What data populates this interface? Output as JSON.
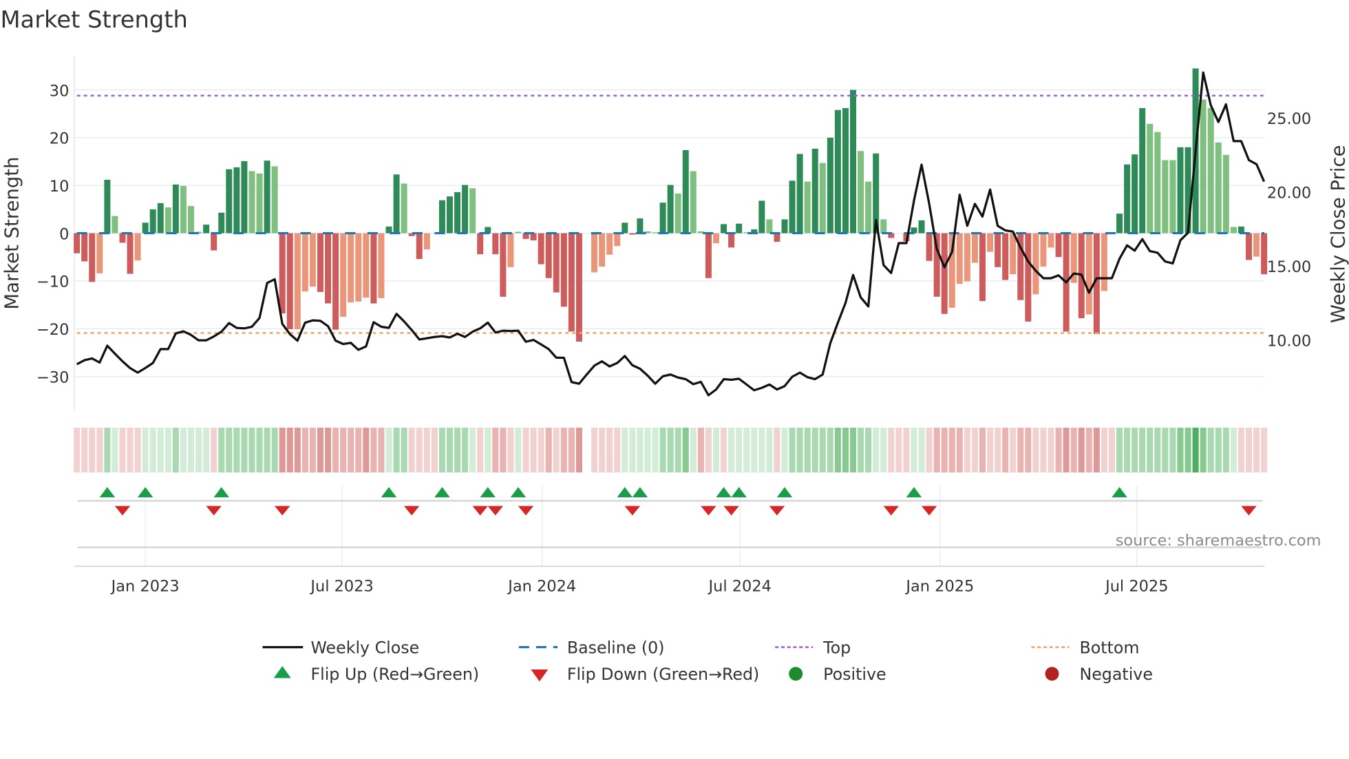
{
  "title": "Market Strength",
  "source": "source: sharemaestro.com",
  "chart_data": {
    "type": "bar+line",
    "title": "Market Strength",
    "ylabel": "Market Strength",
    "y2label": "Weekly Close Price",
    "ylim": [
      -37.2,
      37.1
    ],
    "y2lim": [
      5.17,
      29.19
    ],
    "start_date": "2022-10-30",
    "interval_days": 7,
    "y_ticks": [
      {
        "v": 30,
        "label": "30"
      },
      {
        "v": 20,
        "label": "20"
      },
      {
        "v": 10,
        "label": "10"
      },
      {
        "v": 0,
        "label": "0"
      },
      {
        "v": -10,
        "label": "−10"
      },
      {
        "v": -20,
        "label": "−20"
      },
      {
        "v": -30,
        "label": "−30"
      }
    ],
    "y2_ticks": [
      {
        "v": 25,
        "label": "25.00"
      },
      {
        "v": 20,
        "label": "20.00"
      },
      {
        "v": 15,
        "label": "15.00"
      },
      {
        "v": 10,
        "label": "10.00"
      }
    ],
    "x_ticks": [
      {
        "date": "2023-01-01",
        "label": "Jan 2023"
      },
      {
        "date": "2023-07-01",
        "label": "Jul 2023"
      },
      {
        "date": "2024-01-01",
        "label": "Jan 2024"
      },
      {
        "date": "2024-07-01",
        "label": "Jul 2024"
      },
      {
        "date": "2025-01-01",
        "label": "Jan 2025"
      },
      {
        "date": "2025-07-01",
        "label": "Jul 2025"
      }
    ],
    "top": 28.8,
    "bottom": -20.9,
    "baseline": 0,
    "colors": {
      "strong_up": "#2e8b57",
      "weak_up": "#7fbf7f",
      "strong_down": "#cd5c5c",
      "weak_down": "#e9967a",
      "baseline": "#1f77b4",
      "top": "#9b5fd6",
      "bottom": "#f4a261",
      "line": "#111111",
      "flip_up": "#1a9c48",
      "flip_down": "#d62728",
      "positive": "#1e8c2e",
      "negative": "#b22222"
    },
    "strength": [
      -4.2,
      -5.9,
      -10.2,
      -8.4,
      11.2,
      3.6,
      -2.0,
      -8.5,
      -5.7,
      2.2,
      5.0,
      6.3,
      5.4,
      10.2,
      9.9,
      5.7,
      0.3,
      1.8,
      -3.6,
      4.3,
      13.4,
      13.8,
      15.1,
      13.0,
      12.5,
      15.2,
      14.0,
      -16.8,
      -20.1,
      -20.1,
      -12.2,
      -11.2,
      -12.3,
      -14.7,
      -20.2,
      -17.5,
      -14.5,
      -14.3,
      -13.5,
      -14.7,
      -13.6,
      1.4,
      12.3,
      10.4,
      -0.6,
      -5.4,
      -3.4,
      0,
      6.9,
      7.7,
      8.6,
      10.1,
      9.4,
      -4.4,
      1.3,
      -4.4,
      -13.3,
      -7.1,
      0.3,
      -1.2,
      -1.5,
      -6.5,
      -9.4,
      -12.4,
      -15.4,
      -20.6,
      -22.7,
      0,
      -8.2,
      -7.0,
      -4.5,
      -2.7,
      2.2,
      -0.3,
      3.1,
      0.4,
      0.2,
      6.4,
      10.1,
      8.3,
      17.4,
      13.0,
      0.4,
      -9.4,
      -2.1,
      1.9,
      -3.0,
      2.0,
      0.2,
      0.8,
      6.8,
      2.9,
      -1.8,
      2.9,
      11.0,
      16.6,
      10.8,
      17.7,
      14.7,
      20.0,
      25.8,
      26.2,
      30.0,
      17.2,
      10.8,
      16.7,
      2.9,
      -1.0,
      0,
      -1.7,
      1.2,
      2.7,
      -5.8,
      -13.3,
      -16.9,
      -15.6,
      -10.6,
      -10.1,
      -6.2,
      -14.2,
      -3.9,
      -7.1,
      -9.8,
      -8.6,
      -14.0,
      -18.5,
      -12.8,
      -7.0,
      -3.0,
      -5.0,
      -20.6,
      -10.4,
      -17.8,
      -17.0,
      -21.1,
      -12.1,
      0,
      4.1,
      14.4,
      16.5,
      26.2,
      22.9,
      21.2,
      15.3,
      15.3,
      18.0,
      18.0,
      34.5,
      28.0,
      26.2,
      19.0,
      16.4,
      1.3,
      1.4,
      -5.6,
      -4.9,
      -8.6
    ],
    "strength_class": [
      "R",
      "R",
      "R",
      "o",
      "G",
      "g",
      "R",
      "R",
      "o",
      "G",
      "G",
      "G",
      "g",
      "G",
      "g",
      "g",
      "g",
      "G",
      "R",
      "G",
      "G",
      "G",
      "G",
      "g",
      "g",
      "G",
      "g",
      "R",
      "R",
      "o",
      "o",
      "o",
      "R",
      "R",
      "R",
      "o",
      "o",
      "o",
      "o",
      "R",
      "o",
      "G",
      "G",
      "g",
      "R",
      "R",
      "o",
      "0",
      "G",
      "G",
      "G",
      "G",
      "g",
      "R",
      "G",
      "R",
      "R",
      "o",
      "g",
      "R",
      "R",
      "R",
      "R",
      "R",
      "R",
      "R",
      "R",
      "0",
      "o",
      "o",
      "o",
      "o",
      "G",
      "R",
      "G",
      "g",
      "g",
      "G",
      "G",
      "g",
      "G",
      "g",
      "g",
      "R",
      "o",
      "G",
      "R",
      "G",
      "g",
      "G",
      "G",
      "g",
      "R",
      "G",
      "G",
      "G",
      "g",
      "G",
      "g",
      "G",
      "G",
      "G",
      "G",
      "g",
      "g",
      "G",
      "g",
      "R",
      "0",
      "R",
      "G",
      "G",
      "R",
      "R",
      "R",
      "o",
      "o",
      "o",
      "o",
      "R",
      "o",
      "R",
      "R",
      "o",
      "R",
      "R",
      "o",
      "o",
      "o",
      "R",
      "R",
      "o",
      "R",
      "o",
      "R",
      "o",
      "0",
      "G",
      "G",
      "G",
      "G",
      "g",
      "g",
      "g",
      "g",
      "G",
      "G",
      "G",
      "g",
      "g",
      "g",
      "g",
      "g",
      "G",
      "R",
      "o",
      "R"
    ],
    "close": [
      8.36,
      8.63,
      8.75,
      8.47,
      9.61,
      9.07,
      8.55,
      8.1,
      7.79,
      8.1,
      8.44,
      9.38,
      9.38,
      10.44,
      10.58,
      10.34,
      9.97,
      9.97,
      10.23,
      10.55,
      11.14,
      10.81,
      10.78,
      10.89,
      11.48,
      13.85,
      14.1,
      11.09,
      10.39,
      9.95,
      11.17,
      11.32,
      11.29,
      10.93,
      9.95,
      9.72,
      9.8,
      9.33,
      9.56,
      11.2,
      10.89,
      10.81,
      11.76,
      11.25,
      10.67,
      10.03,
      10.11,
      10.2,
      10.25,
      10.16,
      10.42,
      10.2,
      10.55,
      10.78,
      11.17,
      10.5,
      10.62,
      10.6,
      10.62,
      9.88,
      10.0,
      9.69,
      9.38,
      8.8,
      8.79,
      7.15,
      7.04,
      7.66,
      8.26,
      8.55,
      8.21,
      8.44,
      8.91,
      8.29,
      8.05,
      7.59,
      7.04,
      7.54,
      7.66,
      7.46,
      7.35,
      7.01,
      7.17,
      6.26,
      6.65,
      7.35,
      7.31,
      7.38,
      6.99,
      6.6,
      6.76,
      6.99,
      6.65,
      6.88,
      7.51,
      7.79,
      7.48,
      7.35,
      7.66,
      9.77,
      11.17,
      12.49,
      14.39,
      12.88,
      12.26,
      18.1,
      15.06,
      14.52,
      16.54,
      16.54,
      19.42,
      21.84,
      19.19,
      16.15,
      14.91,
      15.95,
      19.81,
      17.71,
      19.19,
      18.33,
      20.16,
      17.71,
      17.4,
      17.32,
      16.23,
      15.3,
      14.67,
      14.17,
      14.17,
      14.36,
      13.89,
      14.49,
      14.41,
      13.19,
      14.17,
      14.17,
      14.17,
      15.48,
      16.39,
      16.03,
      16.81,
      16.0,
      15.89,
      15.3,
      15.17,
      16.73,
      17.24,
      22.77,
      28.07,
      25.86,
      24.72,
      25.92,
      23.43,
      23.43,
      22.15,
      21.87,
      20.7
    ],
    "heat": [
      -1,
      -1,
      -1,
      -1,
      2,
      1,
      -1,
      -1,
      -1,
      1,
      1,
      1,
      1,
      2,
      1,
      1,
      1,
      1,
      -1,
      2,
      2,
      2,
      2,
      2,
      2,
      2,
      2,
      -3,
      -3,
      -3,
      -2,
      -2,
      -3,
      -3,
      -2,
      -2,
      -2,
      -2,
      -3,
      -2,
      -2,
      1,
      2,
      2,
      -1,
      -1,
      -1,
      -1,
      2,
      2,
      2,
      2,
      1,
      -1,
      1,
      -2,
      -2,
      -1,
      1,
      -1,
      -1,
      -1,
      -2,
      -1,
      -2,
      -2,
      -3,
      null,
      -1,
      -1,
      -1,
      -1,
      1,
      1,
      1,
      1,
      1,
      2,
      2,
      2,
      3,
      1,
      -2,
      -1,
      1,
      -1,
      1,
      1,
      1,
      1,
      1,
      1,
      -1,
      1,
      2,
      2,
      2,
      2,
      2,
      2,
      3,
      3,
      3,
      2,
      2,
      1,
      1,
      -1,
      -1,
      -1,
      1,
      1,
      -1,
      -2,
      -2,
      -2,
      -2,
      -1,
      -1,
      -2,
      -1,
      -1,
      -2,
      -1,
      -2,
      -2,
      -1,
      -1,
      -1,
      -2,
      -3,
      -2,
      -3,
      -2,
      -3,
      -1,
      -1,
      2,
      2,
      2,
      2,
      2,
      2,
      2,
      2,
      3,
      3,
      4,
      3,
      2,
      2,
      2,
      1,
      -1,
      -1,
      -1,
      -1
    ],
    "flip_up_weeks": [
      5,
      10,
      20,
      42,
      49,
      55,
      59,
      73,
      75,
      86,
      88,
      94,
      111,
      138
    ],
    "flip_down_weeks": [
      7,
      19,
      28,
      45,
      54,
      56,
      60,
      74,
      84,
      87,
      93,
      108,
      113,
      155
    ],
    "legend": {
      "weekly_close": "Weekly Close",
      "baseline": "Baseline (0)",
      "top": "Top",
      "bottom": "Bottom",
      "flip_up": "Flip Up (Red→Green)",
      "flip_down": "Flip Down (Green→Red)",
      "positive": "Positive",
      "negative": "Negative"
    }
  }
}
